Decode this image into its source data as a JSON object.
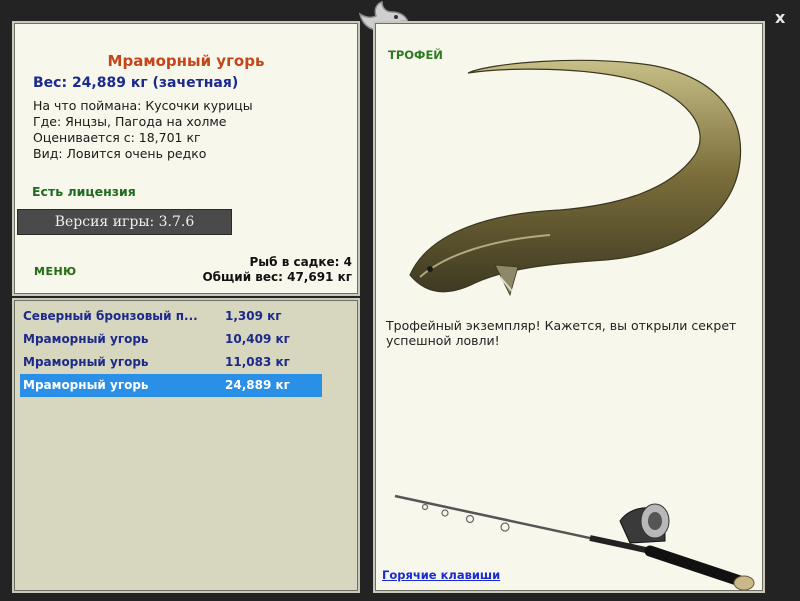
{
  "window": {
    "close_label": "x"
  },
  "fish": {
    "name": "Мраморный угорь",
    "weight": "Вес: 24,889 кг (зачетная)",
    "bait": "На что поймана: Кусочки курицы",
    "location": "Где: Янцзы, Пагода на холме",
    "valued_from": "Оценивается с: 18,701 кг",
    "kind": "Вид: Ловится очень редко"
  },
  "license": "Есть лицензия",
  "version": "Версия игры: 3.7.6",
  "menu_label": "МЕНЮ",
  "keepnet": {
    "count": "Рыб в садке: 4",
    "total": "Общий вес: 47,691 кг"
  },
  "catch_list": [
    {
      "name": "Северный бронзовый п...",
      "weight": "1,309 кг",
      "selected": false
    },
    {
      "name": "Мраморный угорь",
      "weight": "10,409 кг",
      "selected": false
    },
    {
      "name": "Мраморный угорь",
      "weight": "11,083 кг",
      "selected": false
    },
    {
      "name": "Мраморный угорь",
      "weight": "24,889 кг",
      "selected": true
    }
  ],
  "trophy": {
    "badge": "ТРОФЕЙ",
    "text": "Трофейный экземпляр! Кажется, вы открыли секрет успешной ловли!"
  },
  "hotkeys_label": "Горячие клавиши",
  "icons": [
    "fish-logo-icon",
    "eel-image",
    "fishing-rod-image"
  ],
  "colors": {
    "fish_name": "#c4451a",
    "weight": "#1b2a8c",
    "selection": "#2a8fe6",
    "license": "#1f6b1f"
  }
}
